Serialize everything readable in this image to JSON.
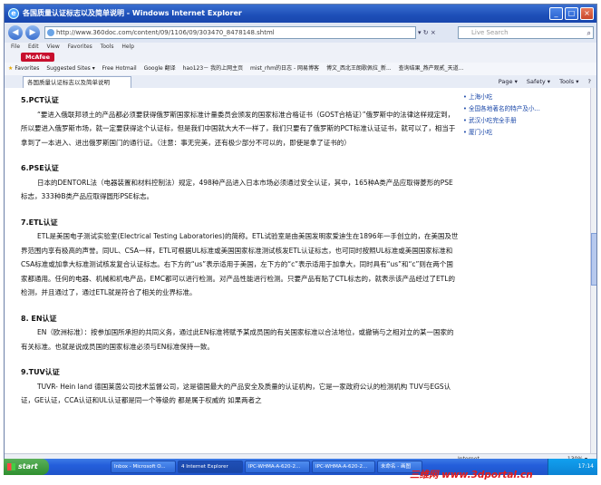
{
  "window": {
    "title": "各国质量认证标志以及简单说明 - Windows Internet Explorer",
    "minimize": "_",
    "maximize": "□",
    "close": "×"
  },
  "address": {
    "url": "http://www.360doc.com/content/09/1106/09/303470_8478148.shtml",
    "go": "▾ ↻ ×",
    "search_placeholder": "Live Search"
  },
  "menu": [
    "File",
    "Edit",
    "View",
    "Favorites",
    "Tools",
    "Help"
  ],
  "toolbar": {
    "mcafee": "McAfee"
  },
  "favorites": {
    "label": "Favorites",
    "items": [
      "Suggested Sites ▾",
      "Free Hotmail",
      "Google 翻译",
      "hao123－ 我的上网主页",
      "mist_rhm的日志 - 网易博客",
      "博文_西北王朗歌佩拉_新...",
      "查询结果_燕产观贰_天道..."
    ]
  },
  "tab": {
    "label": "各国质量认证标志以及简单说明"
  },
  "command": [
    "Page ▾",
    "Safety ▾",
    "Tools ▾",
    "?"
  ],
  "article": {
    "sections": [
      {
        "heading": "5.PCT认证",
        "body": "“要进入俄联邦领土的产品都必须要获得俄罗斯国家标准计量委员会颁发的国家标准合格证书（GOST合格证）”俄罗斯中的法律这样规定到，所以要进入俄罗斯市场，就一定要获得这个认证标，但是我们中国就大大不一样了，我们只要有了俄罗斯的PCT标准认证证书，就可以了，相当于拿到了一本进入、进出俄罗斯国门的通行证。（注意：事无完美，还有极少部分不可以的，即使是拿了证书的）"
      },
      {
        "heading": "6.PSE认证",
        "body": "日本的DENTORL法（电器装置和材料控制法）规定，498种产品进入日本市场必须通过安全认证，其中，165种A类产品应取得菱形的PSE标志，333种B类产品应取得圆形PSE标志。"
      },
      {
        "heading": "7.ETL认证",
        "body": "ETL是美国电子测试实验室(Electrical Testing Laboratories)的简称。ETL试验室是由美国发明家爱迪生在1896年一手创立的，在美国及世界范围内享有极高的声誉。同UL、CSA一样，ETL可根据UL标准或美国国家标准测试核发ETL认证标志，也可同时按照UL标准或美国国家标准和CSA标准或加拿大标准测试核发复合认证标志。右下方的“us”表示适用于美国，左下方的“c”表示适用于加拿大，同时具有“us”和“c”则在两个国家都通用。任何的电器、机械和机电产品，EMC都可以进行检测。对产品性能进行检测。只要产品有贴了CTL标志的，就表示该产品经过了ETL的检测，并且通过了，通过ETL就是符合了相关的业界标准。"
      },
      {
        "heading": "8. EN认证",
        "body": "EN（欧洲标准）：按参加国所承担的共同义务，通过此EN标准将赋予某成员国的有关国家标准以合法地位，或撤销与之相对立的某一国家的有关标准。也就是说成员国的国家标准必须与EN标准保持一致。"
      },
      {
        "heading": "9.TUV认证",
        "body": "TUVR- Hein land 德国莱茵公司技术监督公司，这是德国最大的产品安全及质量的认证机构，它是一家政府公认的检测机构 TUV与EGS认证，GE认证，CCA认证和UL认证都是同一个等级的 都是属于权威的 如果两者之"
      }
    ]
  },
  "sidebar": {
    "links": [
      "上海小吃",
      "全国各地著名的特产及小...",
      "武汉小吃完全手册",
      "厦门小吃"
    ]
  },
  "status": {
    "zone": "Internet",
    "zoom": "130%  ▾"
  },
  "taskbar": {
    "start": "start",
    "tasks": [
      "Inbox - Microsoft O...",
      "4 Internet Explorer",
      "IPC-WHMA-A-620-2...",
      "IPC-WHMA-A-620-2...",
      "未命名 - 画图"
    ],
    "clock": "17:14"
  },
  "watermark": "三维网 www.3dportal.cn"
}
